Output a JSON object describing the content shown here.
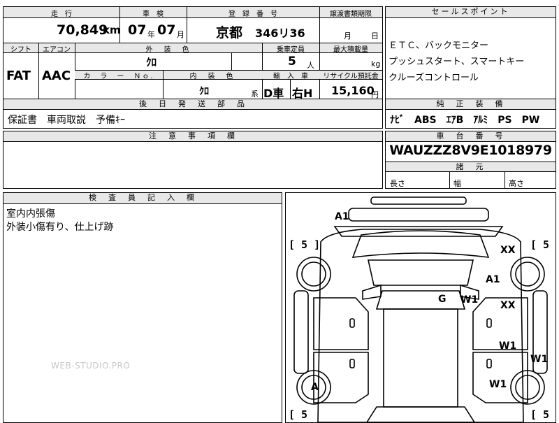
{
  "header": {
    "mileage_label": "走　行",
    "shaken_label": "車　検",
    "reg_label": "登　録　番　号",
    "transfer_label": "譲渡書類期限",
    "points_label": "セールスポイント"
  },
  "row1": {
    "mileage": "70,849",
    "mileage_unit": "km",
    "shaken_year": "07",
    "shaken_year_unit": "年",
    "shaken_month": "07",
    "shaken_month_unit": "月",
    "reg_city": "京都",
    "reg_number": "346リ36",
    "transfer_month_unit": "月",
    "transfer_day_unit": "日"
  },
  "sales_points": [
    "ＥＴＣ、バックモニター",
    "プッシュスタート、スマートキー",
    "クルーズコントロール"
  ],
  "row2": {
    "shift_label": "シフト",
    "ac_label": "エアコン",
    "ext_color_label": "外　装　色",
    "capacity_label": "乗車定員",
    "load_label": "最大積載量",
    "shift": "FAT",
    "ac": "AAC",
    "ext_color": "ｸﾛ",
    "capacity": "5",
    "capacity_unit": "人",
    "load_unit": "kg",
    "color_no_label": "カ　ラ　ー　Ｎｏ.",
    "int_color_label": "内　装　色",
    "import_label": "輸　入　車",
    "recycle_label": "リサイクル預託金",
    "int_color": "ｸﾛ",
    "int_color_unit": "系",
    "import_type": "D車",
    "steering": "右H",
    "recycle_fee": "15,160",
    "recycle_unit": "円"
  },
  "parts": {
    "label": "後　日　発　送　部　品",
    "value": "保証書　車両取説　予備ｷｰ"
  },
  "equipment": {
    "label": "純　正　装　備",
    "value": "ﾅﾋﾞ　ABS　ｴｱB　ｱﾙﾐ　PS　PW"
  },
  "notes": {
    "label": "注　意　事　項　欄"
  },
  "chassis": {
    "label": "車　台　番　号",
    "value": "WAUZZZ8V9E1018979",
    "dims_label": "諸　元",
    "length_label": "長さ",
    "width_label": "幅",
    "height_label": "高さ"
  },
  "inspector": {
    "label": "検　査　員　記　入　欄",
    "line1": "室内内張傷",
    "line2": "外装小傷有り、仕上げ跡"
  },
  "watermark": "WEB-STUDIO.PRO",
  "diagram": {
    "tire_left_top": "[ 5 ]",
    "tire_right_top": "[ 5",
    "tire_left_bottom": "[ 5",
    "tire_right_bottom": "[ 5",
    "marks": {
      "a1_top": "A1",
      "xx_upper": "XX",
      "a1_right": "A1",
      "g": "G",
      "w1_mid": "W1",
      "xx_right": "XX",
      "w1_right": "W1",
      "w1_edge": "W1",
      "w1_low": "W1",
      "a_left": "A"
    }
  }
}
